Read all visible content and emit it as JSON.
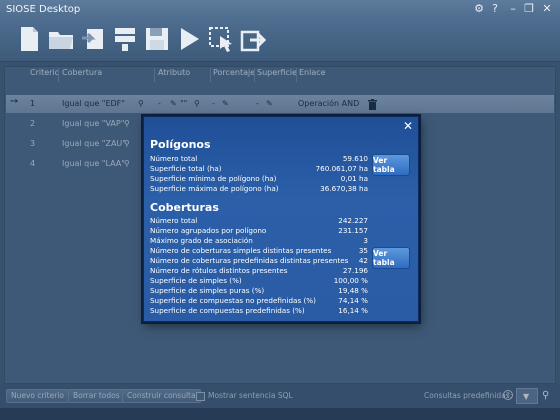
{
  "window": {
    "title": "SIOSE Desktop",
    "controls": [
      "⚙",
      "?",
      "–",
      "❐",
      "✕"
    ]
  },
  "toolbar": {
    "icons": [
      "new-document-icon",
      "open-folder-icon",
      "import-icon",
      "database-icon",
      "save-icon",
      "run-icon",
      "query-select-icon",
      "export-icon"
    ]
  },
  "table": {
    "headers": [
      "Criterio",
      "Cobertura",
      "Atributo",
      "Porcentaje",
      "Superficie",
      "Enlace"
    ],
    "rows": [
      {
        "criterio": "1",
        "cobertura": "Igual que  \"EDF\"",
        "atributo": "-",
        "atributo_val": "\"\"",
        "enlace": "Operación AND"
      },
      {
        "criterio": "2",
        "cobertura": "Igual que  \"VAP\""
      },
      {
        "criterio": "3",
        "cobertura": "Igual que  \"ZAU\""
      },
      {
        "criterio": "4",
        "cobertura": "Igual que  \"LAA\""
      }
    ]
  },
  "modal": {
    "poligonos_title": "Polígonos",
    "poligonos": [
      {
        "label": "Número total",
        "value": "59.610"
      },
      {
        "label": "Superficie total (ha)",
        "value": "760.061,07 ha"
      },
      {
        "label": "Superficie mínima de polígono (ha)",
        "value": "0,01 ha"
      },
      {
        "label": "Superficie máxima de polígono (ha)",
        "value": "36.670,38 ha"
      }
    ],
    "coberturas_title": "Coberturas",
    "coberturas": [
      {
        "label": "Número total",
        "value": "242.227"
      },
      {
        "label": "Número agrupados por polígono",
        "value": "231.157"
      },
      {
        "label": "Máximo grado de asociación",
        "value": "3"
      },
      {
        "label": "Número de coberturas simples distintas presentes",
        "value": "35"
      },
      {
        "label": "Número de coberturas predefinidas distintas presentes",
        "value": "42"
      },
      {
        "label": "Número de rótulos distintos presentes",
        "value": "27.196"
      },
      {
        "label": "Superficie de simples (%)",
        "value": "100,00 %"
      },
      {
        "label": "Superficie de simples puras (%)",
        "value": "19,48 %"
      },
      {
        "label": "Superficie de compuestas no predefinidas (%)",
        "value": "74,14 %"
      },
      {
        "label": "Superficie de compuestas predefinidas (%)",
        "value": "16,14 %"
      }
    ],
    "ver_tabla": "Ver tabla",
    "close": "✕"
  },
  "bottom": {
    "nuevo_criterio": "Nuevo criterio",
    "borrar_todos": "Borrar todos",
    "construir_consulta": "Construir consulta",
    "mostrar_sql": "Mostrar sentencia SQL",
    "consultas_predefinidas": "Consultas predefinidas:"
  },
  "colors": {
    "modal_bg": "#2a5ca5",
    "button": "#2e6cc0",
    "panel": "#4d6b8c"
  }
}
